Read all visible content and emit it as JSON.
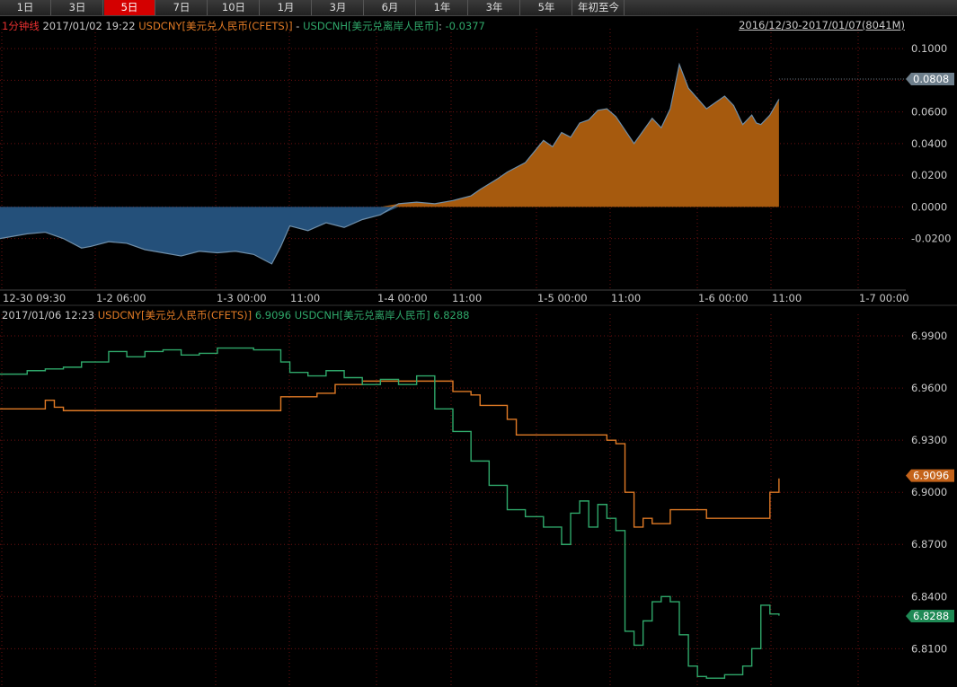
{
  "tabs": [
    {
      "label": "1日",
      "active": false
    },
    {
      "label": "3日",
      "active": false
    },
    {
      "label": "5日",
      "active": true
    },
    {
      "label": "7日",
      "active": false
    },
    {
      "label": "10日",
      "active": false
    },
    {
      "label": "1月",
      "active": false
    },
    {
      "label": "3月",
      "active": false
    },
    {
      "label": "6月",
      "active": false
    },
    {
      "label": "1年",
      "active": false
    },
    {
      "label": "3年",
      "active": false
    },
    {
      "label": "5年",
      "active": false
    },
    {
      "label": "年初至今",
      "active": false
    }
  ],
  "top_header": {
    "interval": "1分钟线",
    "datetime": "2017/01/02 19:22",
    "series_a": "USDCNY[美元兑人民币(CFETS)]",
    "sep": " - ",
    "series_b": "USDCNH[美元兑离岸人民币]",
    "value_sep": ": ",
    "value": "-0.0377",
    "range": "2016/12/30-2017/01/07(8041M)"
  },
  "bottom_header": {
    "datetime": "2017/01/06 12:23",
    "series_a": "USDCNY[美元兑人民币(CFETS)]",
    "value_a": "6.9096",
    "series_b": "USDCNH[美元兑离岸人民币]",
    "value_b": "6.8288"
  },
  "colors": {
    "cny": "#e07a25",
    "cnh": "#2fa86a",
    "spread_pos_fill": "#a65a0e",
    "spread_neg_fill": "#24507a",
    "spread_line": "#6f8ea8",
    "grid": "#6e1010",
    "tab_active": "#d40000",
    "label_red": "#e83030"
  },
  "chart_data": [
    {
      "type": "area",
      "title": "USDCNY - USDCNH spread",
      "x_ticks": [
        "12-30 09:30",
        "1-2 06:00",
        "1-3 00:00",
        "11:00",
        "1-4 00:00",
        "11:00",
        "1-5 00:00",
        "11:00",
        "1-6 00:00",
        "11:00",
        "1-7 00:00"
      ],
      "y_ticks": [
        "0.1000",
        "0.0800",
        "0.0600",
        "0.0400",
        "0.0200",
        "0.0000",
        "-0.0200"
      ],
      "ylim": [
        -0.048,
        0.108
      ],
      "last_value_label": "0.0808",
      "series": [
        {
          "name": "USDCNY - USDCNH",
          "x": [
            0,
            0.03,
            0.05,
            0.07,
            0.09,
            0.1,
            0.12,
            0.14,
            0.16,
            0.18,
            0.2,
            0.22,
            0.24,
            0.26,
            0.28,
            0.3,
            0.31,
            0.32,
            0.34,
            0.36,
            0.38,
            0.4,
            0.42,
            0.44,
            0.46,
            0.48,
            0.5,
            0.52,
            0.53,
            0.55,
            0.56,
            0.58,
            0.6,
            0.61,
            0.62,
            0.63,
            0.64,
            0.65,
            0.66,
            0.67,
            0.68,
            0.7,
            0.72,
            0.73,
            0.74,
            0.75,
            0.76,
            0.78,
            0.8,
            0.81,
            0.82,
            0.83,
            0.835,
            0.84,
            0.85,
            0.86
          ],
          "y": [
            -0.02,
            -0.017,
            -0.016,
            -0.02,
            -0.026,
            -0.025,
            -0.022,
            -0.023,
            -0.027,
            -0.029,
            -0.031,
            -0.028,
            -0.029,
            -0.028,
            -0.03,
            -0.036,
            -0.025,
            -0.012,
            -0.015,
            -0.01,
            -0.013,
            -0.008,
            -0.005,
            0.002,
            0.003,
            0.002,
            0.004,
            0.007,
            0.011,
            0.018,
            0.022,
            0.028,
            0.042,
            0.038,
            0.047,
            0.044,
            0.053,
            0.055,
            0.061,
            0.062,
            0.057,
            0.04,
            0.056,
            0.05,
            0.062,
            0.09,
            0.075,
            0.062,
            0.07,
            0.064,
            0.052,
            0.058,
            0.053,
            0.052,
            0.058,
            0.068
          ]
        }
      ]
    },
    {
      "type": "line",
      "x_ticks": [
        "12-30 09:30",
        "1-2 06:00",
        "1-3 00:00",
        "11:00",
        "1-4 00:00",
        "11:00",
        "1-5 00:00",
        "11:00",
        "1-6 00:00",
        "11:00",
        "1-7 00:00"
      ],
      "y_ticks": [
        "6.9900",
        "6.9600",
        "6.9300",
        "6.9000",
        "6.8700",
        "6.8400",
        "6.8100"
      ],
      "ylim": [
        6.7895,
        6.9983
      ],
      "series": [
        {
          "name": "USDCNY[美元兑人民币(CFETS)]",
          "last": "6.9096",
          "x": [
            0,
            0.05,
            0.06,
            0.07,
            0.1,
            0.2,
            0.3,
            0.31,
            0.35,
            0.36,
            0.37,
            0.39,
            0.4,
            0.45,
            0.48,
            0.5,
            0.52,
            0.53,
            0.56,
            0.57,
            0.66,
            0.67,
            0.68,
            0.69,
            0.7,
            0.71,
            0.72,
            0.74,
            0.76,
            0.78,
            0.8,
            0.84,
            0.85,
            0.86
          ],
          "y": [
            6.948,
            6.953,
            6.949,
            6.947,
            6.947,
            6.947,
            6.947,
            6.955,
            6.957,
            6.957,
            6.962,
            6.962,
            6.964,
            6.964,
            6.964,
            6.958,
            6.956,
            6.95,
            6.942,
            6.933,
            6.933,
            6.93,
            6.928,
            6.9,
            6.88,
            6.885,
            6.882,
            6.89,
            6.89,
            6.885,
            6.885,
            6.885,
            6.9,
            6.908
          ]
        },
        {
          "name": "USDCNH[美元兑离岸人民币]",
          "last": "6.8288",
          "x": [
            0,
            0.03,
            0.05,
            0.07,
            0.09,
            0.12,
            0.14,
            0.16,
            0.18,
            0.2,
            0.22,
            0.24,
            0.26,
            0.28,
            0.3,
            0.31,
            0.32,
            0.34,
            0.36,
            0.38,
            0.4,
            0.42,
            0.44,
            0.46,
            0.48,
            0.5,
            0.52,
            0.54,
            0.56,
            0.58,
            0.6,
            0.62,
            0.63,
            0.64,
            0.65,
            0.66,
            0.67,
            0.68,
            0.69,
            0.7,
            0.71,
            0.72,
            0.73,
            0.74,
            0.75,
            0.76,
            0.77,
            0.78,
            0.8,
            0.82,
            0.83,
            0.84,
            0.85,
            0.86
          ],
          "y": [
            6.968,
            6.97,
            6.971,
            6.972,
            6.975,
            6.981,
            6.978,
            6.981,
            6.982,
            6.979,
            6.98,
            6.983,
            6.983,
            6.982,
            6.982,
            6.975,
            6.969,
            6.967,
            6.97,
            6.966,
            6.962,
            6.965,
            6.962,
            6.967,
            6.948,
            6.935,
            6.918,
            6.904,
            6.89,
            6.886,
            6.88,
            6.87,
            6.888,
            6.895,
            6.88,
            6.893,
            6.885,
            6.878,
            6.82,
            6.812,
            6.826,
            6.837,
            6.84,
            6.837,
            6.818,
            6.8,
            6.794,
            6.793,
            6.795,
            6.8,
            6.81,
            6.835,
            6.83,
            6.829
          ]
        }
      ]
    }
  ]
}
